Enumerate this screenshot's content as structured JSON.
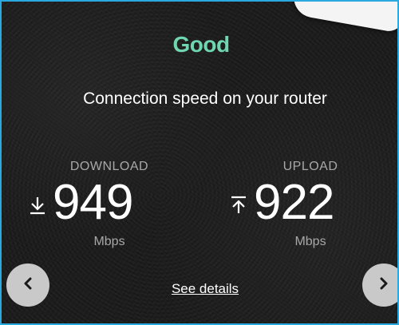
{
  "status": {
    "label": "Good",
    "color": "#6fd6b0"
  },
  "subtitle": "Connection speed on your router",
  "download": {
    "label": "DOWNLOAD",
    "value": "949",
    "unit": "Mbps",
    "icon": "download-arrow-icon"
  },
  "upload": {
    "label": "UPLOAD",
    "value": "922",
    "unit": "Mbps",
    "icon": "upload-arrow-icon"
  },
  "nav": {
    "prev_icon": "chevron-left-icon",
    "next_icon": "chevron-right-icon"
  },
  "link": {
    "see_details": "See details"
  },
  "colors": {
    "accent": "#6fd6b0",
    "frame_border": "#2aa8e0",
    "background": "#1c1c1c"
  }
}
